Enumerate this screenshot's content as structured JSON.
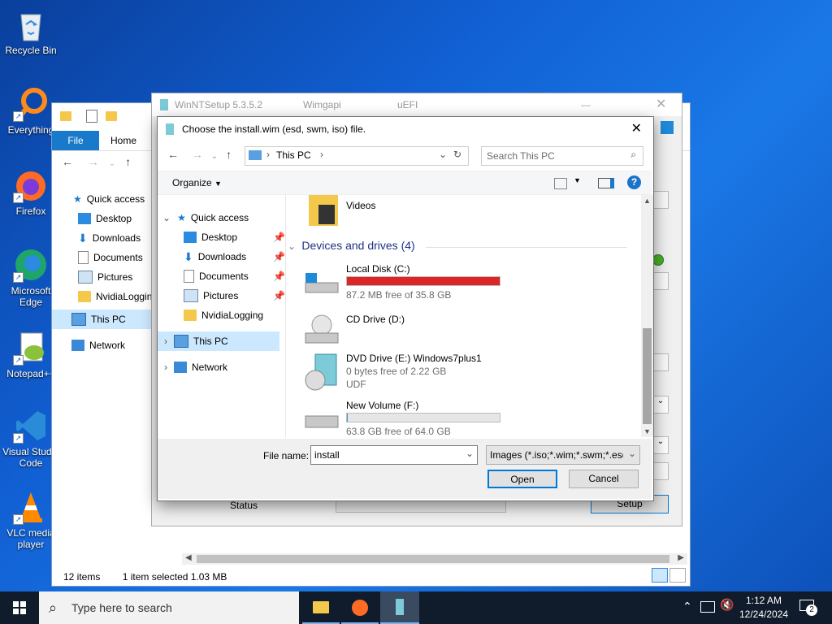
{
  "desktop": {
    "icons": [
      {
        "label": "Recycle Bin"
      },
      {
        "label": "Everything"
      },
      {
        "label": "Firefox"
      },
      {
        "label": "Microsoft Edge"
      },
      {
        "label": "Notepad++"
      },
      {
        "label": "Visual Studio Code"
      },
      {
        "label": "VLC media player"
      }
    ]
  },
  "explorer": {
    "tabs": {
      "file": "File",
      "home": "Home"
    },
    "nav": {
      "quick_access": "Quick access",
      "desktop": "Desktop",
      "downloads": "Downloads",
      "documents": "Documents",
      "pictures": "Pictures",
      "nvidia": "NvidiaLogging",
      "this_pc": "This PC",
      "network": "Network"
    },
    "status": {
      "items": "12 items",
      "selected": "1 item selected  1.03 MB"
    }
  },
  "wnt": {
    "title": "WinNTSetup 5.3.5.2",
    "wimgapi": "Wimgapi",
    "uefi": "uEFI",
    "status_label": "Status",
    "setup_button": "Setup"
  },
  "dialog": {
    "title": "Choose the install.wim (esd, swm, iso) file.",
    "address": "This PC",
    "search_placeholder": "Search This PC",
    "organize": "Organize",
    "tree": {
      "quick_access": "Quick access",
      "desktop": "Desktop",
      "downloads": "Downloads",
      "documents": "Documents",
      "pictures": "Pictures",
      "nvidia": "NvidiaLogging",
      "this_pc": "This PC",
      "network": "Network"
    },
    "videos": "Videos",
    "group_header": "Devices and drives (4)",
    "drives": [
      {
        "name": "Local Disk (C:)",
        "free": "87.2 MB free of 35.8 GB",
        "used_fraction": 0.998,
        "bar_color": "#da2626"
      },
      {
        "name": "CD Drive (D:)"
      },
      {
        "name": "DVD Drive (E:) Windows7plus1",
        "free": "0 bytes free of 2.22 GB",
        "fs": "UDF"
      },
      {
        "name": "New Volume (F:)",
        "free": "63.8 GB free of 64.0 GB",
        "used_fraction": 0.003,
        "bar_color": "#26a0da"
      }
    ],
    "filename_label": "File name:",
    "filename_value": "install",
    "filter": "Images (*.iso;*.wim;*.swm;*.esd)",
    "open": "Open",
    "cancel": "Cancel"
  },
  "taskbar": {
    "search_placeholder": "Type here to search",
    "time": "1:12 AM",
    "date": "12/24/2024",
    "notifications": "2"
  }
}
